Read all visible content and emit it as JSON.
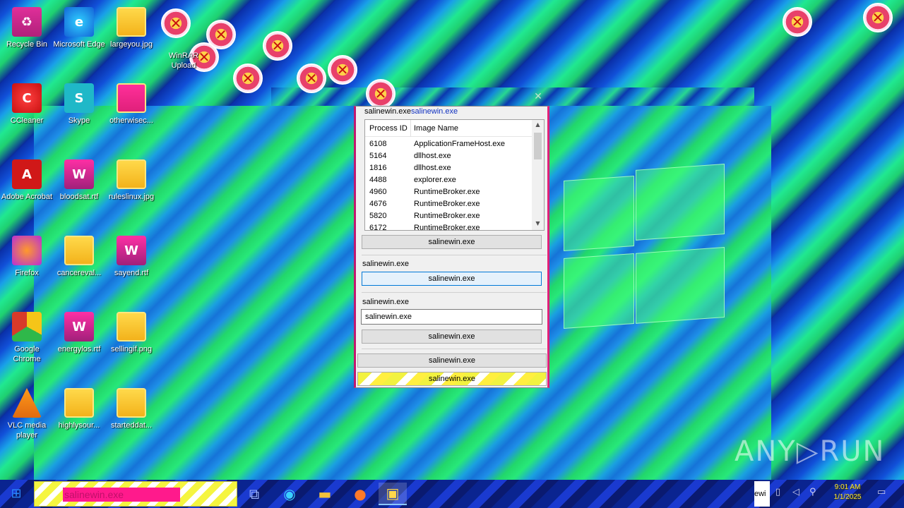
{
  "desktop": {
    "icons": [
      {
        "label": "Recycle Bin",
        "icon": "recycle-bin-icon",
        "glyph": "♻"
      },
      {
        "label": "Microsoft Edge",
        "icon": "edge-icon",
        "glyph": "e"
      },
      {
        "label": "largeyou.jpg",
        "icon": "image-file-icon",
        "glyph": ""
      },
      {
        "label": "WinRAR Upload",
        "icon": "glitch-icon",
        "glyph": ""
      },
      {
        "label": "CCleaner",
        "icon": "ccleaner-icon",
        "glyph": "C"
      },
      {
        "label": "Skype",
        "icon": "skype-icon",
        "glyph": "S"
      },
      {
        "label": "otherwisec...",
        "icon": "image-file-icon",
        "glyph": ""
      },
      {
        "label": "Adobe Acrobat",
        "icon": "acrobat-icon",
        "glyph": "A"
      },
      {
        "label": "bloodsat.rtf",
        "icon": "word-file-icon",
        "glyph": "W"
      },
      {
        "label": "ruleslinux.jpg",
        "icon": "image-file-icon",
        "glyph": ""
      },
      {
        "label": "Firefox",
        "icon": "firefox-icon",
        "glyph": ""
      },
      {
        "label": "cancereval...",
        "icon": "image-file-icon",
        "glyph": ""
      },
      {
        "label": "sayend.rtf",
        "icon": "word-file-icon",
        "glyph": "W"
      },
      {
        "label": "Google Chrome",
        "icon": "chrome-icon",
        "glyph": ""
      },
      {
        "label": "energylos.rtf",
        "icon": "word-file-icon",
        "glyph": "W"
      },
      {
        "label": "sellingif.png",
        "icon": "image-file-icon",
        "glyph": ""
      },
      {
        "label": "VLC media player",
        "icon": "vlc-icon",
        "glyph": ""
      },
      {
        "label": "highlysour...",
        "icon": "image-file-icon",
        "glyph": ""
      },
      {
        "label": "starteddat...",
        "icon": "image-file-icon",
        "glyph": ""
      }
    ]
  },
  "dialog": {
    "title_a": "salinewin.exe",
    "title_b": "salinewin.exe",
    "list": {
      "headers": [
        "Process ID",
        "Image Name"
      ],
      "rows": [
        {
          "pid": "6108",
          "name": "ApplicationFrameHost.exe"
        },
        {
          "pid": "5164",
          "name": "dllhost.exe"
        },
        {
          "pid": "1816",
          "name": "dllhost.exe"
        },
        {
          "pid": "4488",
          "name": "explorer.exe"
        },
        {
          "pid": "4960",
          "name": "RuntimeBroker.exe"
        },
        {
          "pid": "4676",
          "name": "RuntimeBroker.exe"
        },
        {
          "pid": "5820",
          "name": "RuntimeBroker.exe"
        },
        {
          "pid": "6172",
          "name": "RuntimeBroker.exe"
        }
      ]
    },
    "button1": "salinewin.exe",
    "section2_label": "salinewin.exe",
    "button2": "salinewin.exe",
    "section3_label": "salinewin.exe",
    "input_value": "salinewin.exe",
    "button3": "salinewin.exe",
    "button4": "salinewin.exe",
    "button5": "salinewin.exe",
    "close": "✕"
  },
  "taskbar": {
    "search_text": "salinewin.exe",
    "tray_text": "ewi",
    "clock_time": "9:01 AM",
    "clock_date": "1/1/2025"
  },
  "watermark": "ANY▷RUN"
}
